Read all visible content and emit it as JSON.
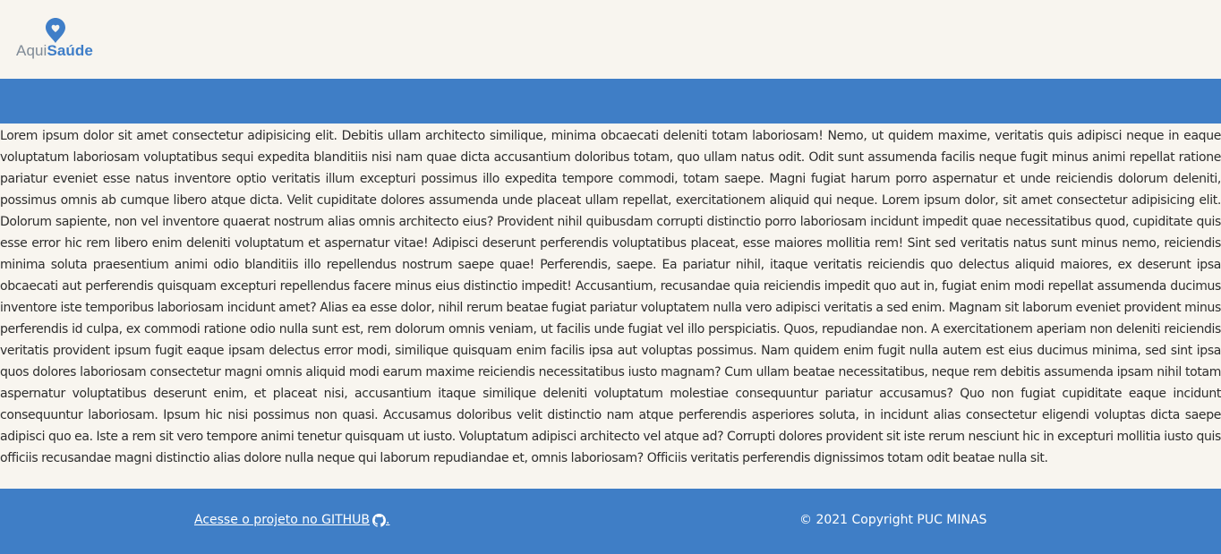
{
  "colors": {
    "background": "#f8f5ef",
    "brand_blue": "#3f7ec6",
    "logo_gray": "#7f8a96",
    "text": "#2d2d2d",
    "footer_text": "#ffffff"
  },
  "header": {
    "logo": {
      "icon": "map-pin-heart-icon",
      "part1": "Aqui",
      "part2": "Saúde"
    }
  },
  "main": {
    "paragraph": "Lorem ipsum dolor sit amet consectetur adipisicing elit. Debitis ullam architecto similique, minima obcaecati deleniti totam laboriosam! Nemo, ut quidem maxime, veritatis quis adipisci neque in eaque voluptatum laboriosam voluptatibus sequi expedita blanditiis nisi nam quae dicta accusantium doloribus totam, quo ullam natus odit. Odit sunt assumenda facilis neque fugit minus animi repellat ratione pariatur eveniet esse natus inventore optio veritatis illum excepturi possimus illo expedita tempore commodi, totam saepe. Magni fugiat harum porro aspernatur et unde reiciendis dolorum deleniti, possimus omnis ab cumque libero atque dicta. Velit cupiditate dolores assumenda unde placeat ullam repellat, exercitationem aliquid qui neque. Lorem ipsum dolor, sit amet consectetur adipisicing elit. Dolorum sapiente, non vel inventore quaerat nostrum alias omnis architecto eius? Provident nihil quibusdam corrupti distinctio porro laboriosam incidunt impedit quae necessitatibus quod, cupiditate quis esse error hic rem libero enim deleniti voluptatum et aspernatur vitae! Adipisci deserunt perferendis voluptatibus placeat, esse maiores mollitia rem! Sint sed veritatis natus sunt minus nemo, reiciendis minima soluta praesentium animi odio blanditiis illo repellendus nostrum saepe quae! Perferendis, saepe. Ea pariatur nihil, itaque veritatis reiciendis quo delectus aliquid maiores, ex deserunt ipsa obcaecati aut perferendis quisquam excepturi repellendus facere minus eius distinctio impedit! Accusantium, recusandae quia reiciendis impedit quo aut in, fugiat enim modi repellat assumenda ducimus inventore iste temporibus laboriosam incidunt amet? Alias ea esse dolor, nihil rerum beatae fugiat pariatur voluptatem nulla vero adipisci veritatis a sed enim. Magnam sit laborum eveniet provident minus perferendis id culpa, ex commodi ratione odio nulla sunt est, rem dolorum omnis veniam, ut facilis unde fugiat vel illo perspiciatis. Quos, repudiandae non. A exercitationem aperiam non deleniti reiciendis veritatis provident ipsum fugit eaque ipsam delectus error modi, similique quisquam enim facilis ipsa aut voluptas possimus. Nam quidem enim fugit nulla autem est eius ducimus minima, sed sint ipsa quos dolores laboriosam consectetur magni omnis aliquid modi earum maxime reiciendis necessitatibus iusto magnam? Cum ullam beatae necessitatibus, neque rem debitis assumenda ipsam nihil totam aspernatur voluptatibus deserunt enim, et placeat nisi, accusantium itaque similique deleniti voluptatum molestiae consequuntur pariatur accusamus? Quo non fugiat cupiditate eaque incidunt consequuntur laboriosam. Ipsum hic nisi possimus non quasi. Accusamus doloribus velit distinctio nam atque perferendis asperiores soluta, in incidunt alias consectetur eligendi voluptas dicta saepe adipisci quo ea. Iste a rem sit vero tempore animi tenetur quisquam ut iusto. Voluptatum adipisci architecto vel atque ad? Corrupti dolores provident sit iste rerum nesciunt hic in excepturi mollitia iusto quis officiis recusandae magni distinctio alias dolore nulla neque qui laborum repudiandae et, omnis laboriosam? Officiis veritatis perferendis dignissimos totam odit beatae nulla sit."
  },
  "footer": {
    "github_link_label": "Acesse o projeto no GITHUB",
    "github_icon": "github-icon",
    "github_link_suffix": ".",
    "copyright": "© 2021 Copyright PUC MINAS"
  }
}
